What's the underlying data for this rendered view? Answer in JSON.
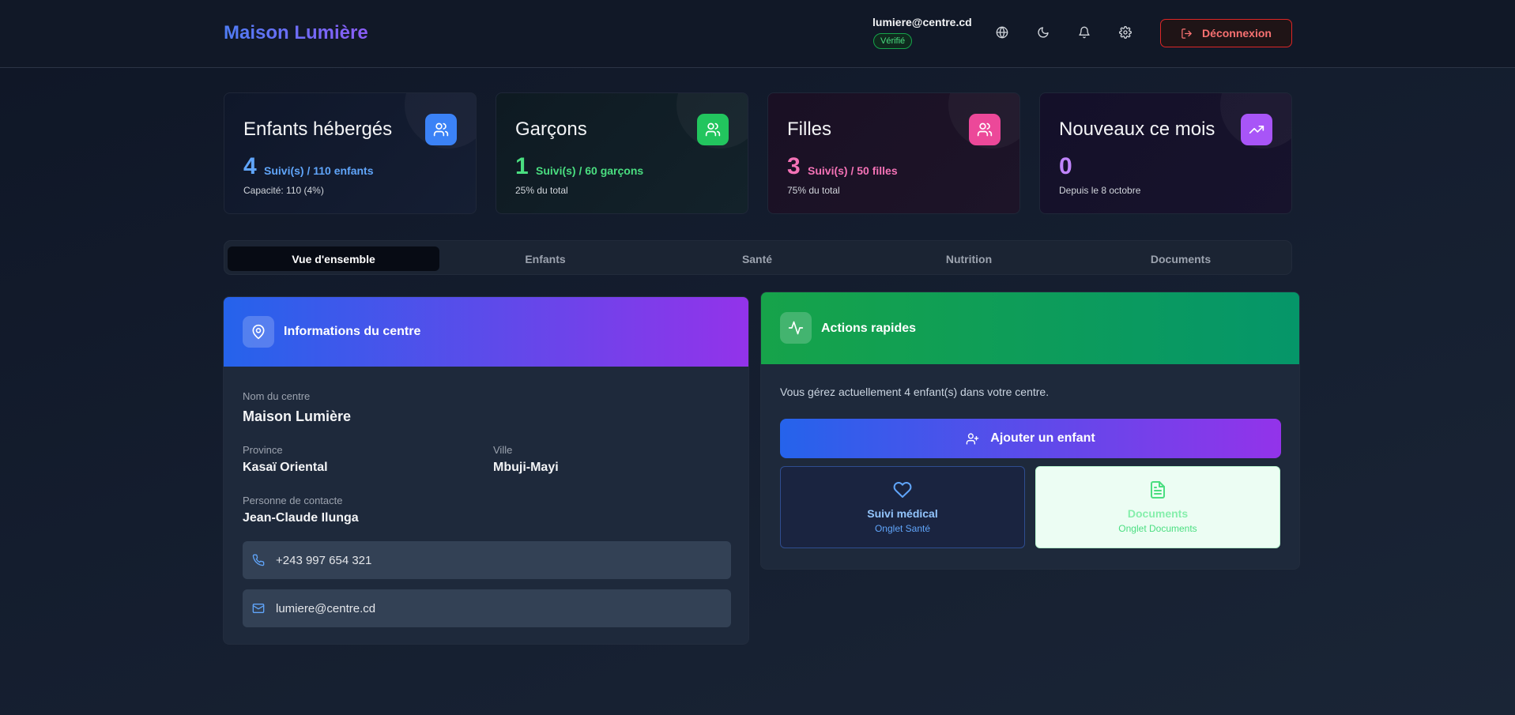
{
  "header": {
    "brand": "Maison Lumière",
    "user_email": "lumiere@centre.cd",
    "verified_badge": "Vérifié",
    "icons": [
      "globe-icon",
      "moon-icon",
      "bell-icon",
      "gear-icon"
    ],
    "logout_label": "Déconnexion"
  },
  "stats": [
    {
      "title": "Enfants hébergés",
      "value": "4",
      "sub": "Suivi(s) / 110 enfants",
      "note": "Capacité: 110 (4%)",
      "icon": "users-icon",
      "color": "#60a5fa",
      "icon_bg": "#3b82f6"
    },
    {
      "title": "Garçons",
      "value": "1",
      "sub": "Suivi(s) / 60 garçons",
      "note": "25% du total",
      "icon": "users-icon",
      "color": "#4ade80",
      "icon_bg": "#22c55e"
    },
    {
      "title": "Filles",
      "value": "3",
      "sub": "Suivi(s) / 50 filles",
      "note": "75% du total",
      "icon": "users-icon",
      "color": "#f472b6",
      "icon_bg": "#ec4899"
    },
    {
      "title": "Nouveaux ce mois",
      "value": "0",
      "sub": "",
      "note": "Depuis le 8 octobre",
      "icon": "trending-up-icon",
      "color": "#c084fc",
      "icon_bg": "#a855f7"
    }
  ],
  "tabs": [
    "Vue d'ensemble",
    "Enfants",
    "Santé",
    "Nutrition",
    "Documents"
  ],
  "active_tab": "Vue d'ensemble",
  "info_panel": {
    "title": "Informations du centre",
    "name_label": "Nom du centre",
    "name_value": "Maison Lumière",
    "province_label": "Province",
    "province_value": "Kasaï Oriental",
    "city_label": "Ville",
    "city_value": "Mbuji-Mayi",
    "contact_label": "Personne de contacte",
    "contact_value": "Jean-Claude Ilunga",
    "phone": "+243 997 654 321",
    "email": "lumiere@centre.cd"
  },
  "actions_panel": {
    "title": "Actions rapides",
    "description": "Vous gérez actuellement 4 enfant(s) dans votre centre.",
    "add_child_label": "Ajouter un enfant",
    "medical_title": "Suivi médical",
    "medical_sub": "Onglet Santé",
    "documents_title": "Documents",
    "documents_sub": "Onglet Documents"
  },
  "colors": {
    "accent_blue": "#2563eb",
    "accent_purple": "#9333ea",
    "accent_green": "#16a34a",
    "danger": "#dc2626"
  }
}
